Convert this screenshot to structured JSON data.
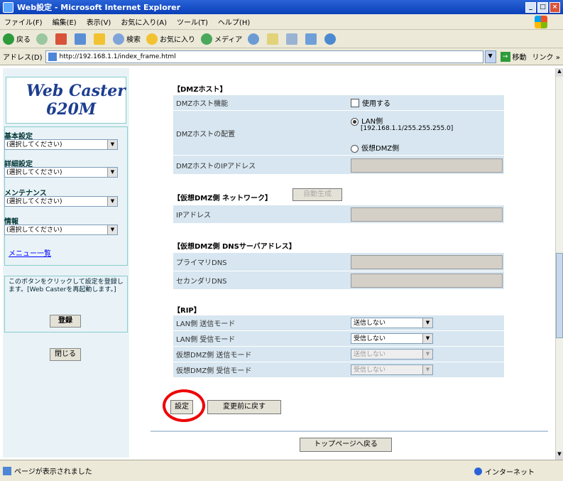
{
  "window": {
    "title": "Web設定 - Microsoft Internet Explorer",
    "controls": [
      "_",
      "□",
      "×"
    ]
  },
  "menubar": [
    "ファイル(F)",
    "編集(E)",
    "表示(V)",
    "お気に入り(A)",
    "ツール(T)",
    "ヘルプ(H)"
  ],
  "toolbar": {
    "back": "戻る",
    "search": "検索",
    "favorites": "お気に入り",
    "media": "メディア"
  },
  "address": {
    "label": "アドレス(D)",
    "url": "http://192.168.1.1/index_frame.html",
    "go": "移動",
    "links": "リンク »"
  },
  "left": {
    "logo_line1": "Web Caster",
    "logo_line2": "620M",
    "groups": [
      {
        "label": "基本設定",
        "value": "(選択してください)"
      },
      {
        "label": "詳細設定",
        "value": "(選択してください)"
      },
      {
        "label": "メンテナンス",
        "value": "(選択してください)"
      },
      {
        "label": "情報",
        "value": "(選択してください)"
      }
    ],
    "menu_link": "メニュー一覧",
    "info": "このボタンをクリックして設定を登録します。[Web Casterを再起動します。]",
    "register": "登録",
    "close": "閉じる"
  },
  "right": {
    "dmz_title": "【DMZホスト】",
    "dmz_func_label": "DMZホスト機能",
    "dmz_func_check": "使用する",
    "dmz_place_label": "DMZホストの配置",
    "dmz_place_lan": "LAN側",
    "dmz_place_lan_addr": "[192.168.1.1/255.255.255.0]",
    "dmz_place_virtual": "仮想DMZ側",
    "dmz_ip_label": "DMZホストのIPアドレス",
    "vnet_title": "【仮想DMZ側 ネットワーク】",
    "vnet_auto": "自動生成",
    "vnet_ip_label": "IPアドレス",
    "dns_title": "【仮想DMZ側 DNSサーバアドレス】",
    "dns_primary": "プライマリDNS",
    "dns_secondary": "セカンダリDNS",
    "rip_title": "【RIP】",
    "rip_rows": [
      {
        "label": "LAN側 送信モード",
        "value": "送信しない",
        "disabled": false
      },
      {
        "label": "LAN側 受信モード",
        "value": "受信しない",
        "disabled": false
      },
      {
        "label": "仮想DMZ側 送信モード",
        "value": "送信しない",
        "disabled": true
      },
      {
        "label": "仮想DMZ側 受信モード",
        "value": "受信しない",
        "disabled": true
      }
    ],
    "set_button": "設定",
    "revert_button": "変更前に戻す",
    "top_button": "トップページへ戻る"
  },
  "status": {
    "text": "ページが表示されました",
    "zone": "インターネット"
  }
}
